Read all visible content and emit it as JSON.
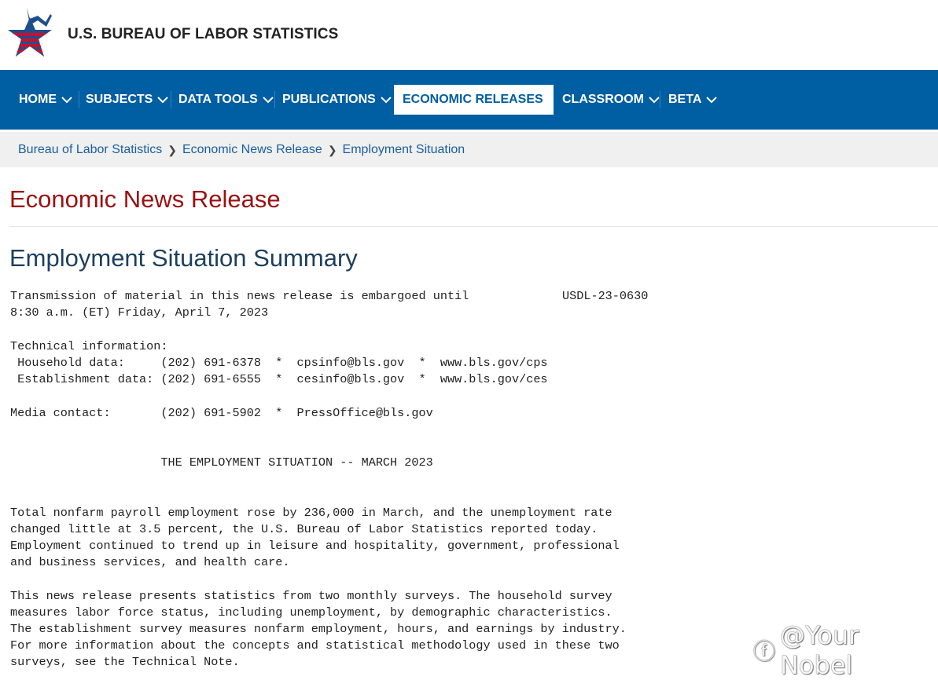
{
  "header": {
    "agency_name": "U.S. BUREAU OF LABOR STATISTICS",
    "logo_icon": "bls-star-logo-icon",
    "colors": {
      "star_blue": "#1f4f8b",
      "stripe_red": "#c8102e"
    }
  },
  "nav": {
    "background": "#005ea2",
    "items": [
      {
        "label": "HOME",
        "active": false
      },
      {
        "label": "SUBJECTS",
        "active": false
      },
      {
        "label": "DATA TOOLS",
        "active": false
      },
      {
        "label": "PUBLICATIONS",
        "active": false
      },
      {
        "label": "ECONOMIC RELEASES",
        "active": true
      },
      {
        "label": "CLASSROOM",
        "active": false
      },
      {
        "label": "BETA",
        "active": false
      }
    ]
  },
  "breadcrumb": [
    "Bureau of Labor Statistics",
    "Economic News Release",
    "Employment Situation"
  ],
  "page_title": "Economic News Release",
  "summary_title": "Employment Situation Summary",
  "release": {
    "embargo_line1": "Transmission of material in this news release is embargoed until",
    "release_number": "USDL-23-0630",
    "embargo_line2": "8:30 a.m. (ET) Friday, April 7, 2023",
    "tech_info_heading": "Technical information:",
    "household_line": " Household data:     (202) 691-6378  *  cpsinfo@bls.gov  *  www.bls.gov/cps",
    "establishment_line": " Establishment data: (202) 691-6555  *  cesinfo@bls.gov  *  www.bls.gov/ces",
    "media_line": "Media contact:       (202) 691-5902  *  PressOffice@bls.gov",
    "headline": "                     THE EMPLOYMENT SITUATION -- MARCH 2023",
    "paragraph1": [
      "Total nonfarm payroll employment rose by 236,000 in March, and the unemployment rate",
      "changed little at 3.5 percent, the U.S. Bureau of Labor Statistics reported today.",
      "Employment continued to trend up in leisure and hospitality, government, professional",
      "and business services, and health care."
    ],
    "paragraph2": [
      "This news release presents statistics from two monthly surveys. The household survey",
      "measures labor force status, including unemployment, by demographic characteristics.",
      "The establishment survey measures nonfarm employment, hours, and earnings by industry.",
      "For more information about the concepts and statistical methodology used in these two",
      "surveys, see the Technical Note."
    ]
  },
  "watermark": {
    "icon": "zhihu-icon",
    "text": "@Your Nobel"
  }
}
